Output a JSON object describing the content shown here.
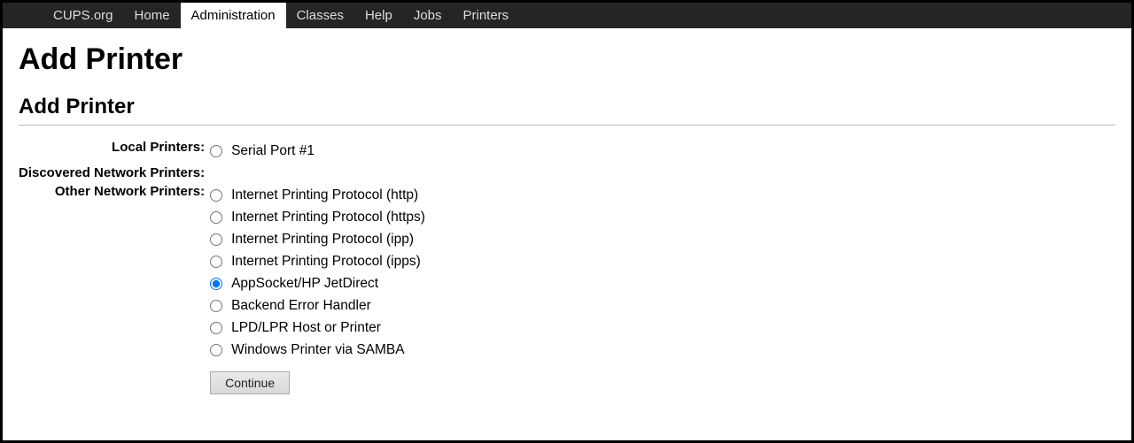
{
  "nav": {
    "items": [
      {
        "label": "CUPS.org",
        "active": false
      },
      {
        "label": "Home",
        "active": false
      },
      {
        "label": "Administration",
        "active": true
      },
      {
        "label": "Classes",
        "active": false
      },
      {
        "label": "Help",
        "active": false
      },
      {
        "label": "Jobs",
        "active": false
      },
      {
        "label": "Printers",
        "active": false
      }
    ]
  },
  "page_title": "Add Printer",
  "section_title": "Add Printer",
  "form": {
    "groups": [
      {
        "label": "Local Printers:",
        "options": [
          {
            "label": "Serial Port #1",
            "checked": false
          }
        ]
      },
      {
        "label": "Discovered Network Printers:",
        "options": []
      },
      {
        "label": "Other Network Printers:",
        "options": [
          {
            "label": "Internet Printing Protocol (http)",
            "checked": false
          },
          {
            "label": "Internet Printing Protocol (https)",
            "checked": false
          },
          {
            "label": "Internet Printing Protocol (ipp)",
            "checked": false
          },
          {
            "label": "Internet Printing Protocol (ipps)",
            "checked": false
          },
          {
            "label": "AppSocket/HP JetDirect",
            "checked": true
          },
          {
            "label": "Backend Error Handler",
            "checked": false
          },
          {
            "label": "LPD/LPR Host or Printer",
            "checked": false
          },
          {
            "label": "Windows Printer via SAMBA",
            "checked": false
          }
        ]
      }
    ],
    "continue_label": "Continue"
  }
}
